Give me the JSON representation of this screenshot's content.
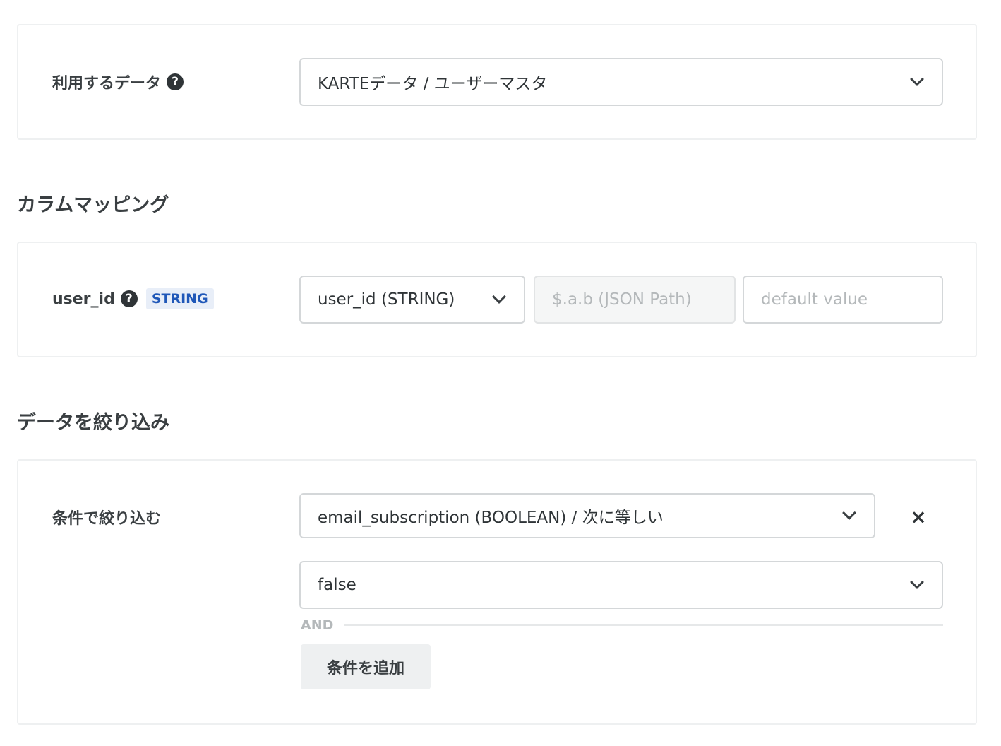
{
  "data_source": {
    "label": "利用するデータ",
    "selected": "KARTEデータ / ユーザーマスタ"
  },
  "column_mapping": {
    "title": "カラムマッピング",
    "field_name": "user_id",
    "field_type": "STRING",
    "source_column": "user_id (STRING)",
    "json_path_placeholder": "$.a.b (JSON Path)",
    "default_value_placeholder": "default value"
  },
  "filter": {
    "title": "データを絞り込み",
    "label": "条件で絞り込む",
    "condition": "email_subscription (BOOLEAN) / 次に等しい",
    "value": "false",
    "operator": "AND",
    "add_button_label": "条件を追加",
    "remove_icon": "×"
  },
  "icons": {
    "help": "?"
  }
}
